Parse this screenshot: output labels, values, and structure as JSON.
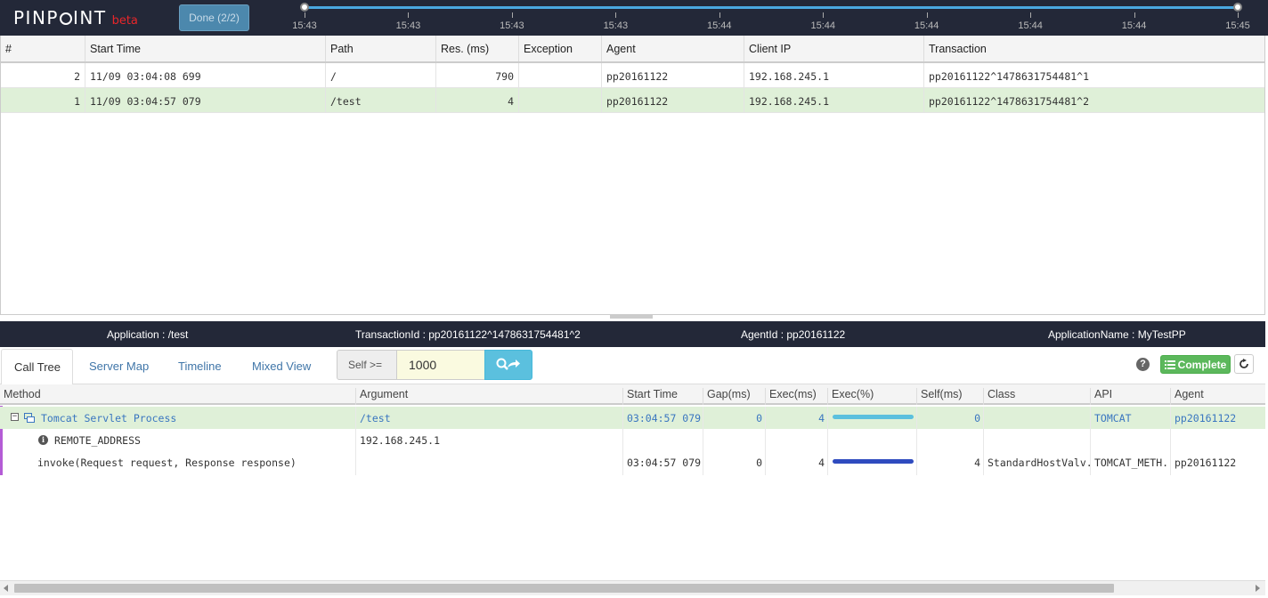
{
  "header": {
    "logo_text_a": "PINP",
    "logo_text_b": "INT",
    "logo_beta": "beta",
    "done_button": "Done (2/2)",
    "timeline_labels": [
      "15:43",
      "15:43",
      "15:43",
      "15:43",
      "15:44",
      "15:44",
      "15:44",
      "15:44",
      "15:44",
      "15:45"
    ],
    "colors": {
      "bg": "#232838",
      "track": "#4aa8e0",
      "beta": "#e8262a"
    }
  },
  "transactions": {
    "columns": [
      "#",
      "Start Time",
      "Path",
      "Res. (ms)",
      "Exception",
      "Agent",
      "Client IP",
      "Transaction"
    ],
    "rows": [
      {
        "num": "2",
        "start_time": "11/09 03:04:08 699",
        "path": "/",
        "res": "790",
        "exception": "",
        "agent": "pp20161122",
        "client_ip": "192.168.245.1",
        "transaction": "pp20161122^1478631754481^1"
      },
      {
        "num": "1",
        "start_time": "11/09 03:04:57 079",
        "path": "/test",
        "res": "4",
        "exception": "",
        "agent": "pp20161122",
        "client_ip": "192.168.245.1",
        "transaction": "pp20161122^1478631754481^2"
      }
    ]
  },
  "infobar": {
    "application": "Application : /test",
    "transaction_id": "TransactionId : pp20161122^1478631754481^2",
    "agent_id": "AgentId : pp20161122",
    "application_name": "ApplicationName : MyTestPP"
  },
  "tabs": {
    "call_tree": "Call Tree",
    "server_map": "Server Map",
    "timeline": "Timeline",
    "mixed_view": "Mixed View",
    "self_label": "Self >=",
    "self_value": "1000",
    "help": "?",
    "complete": "Complete"
  },
  "calltree": {
    "columns": [
      "Method",
      "Argument",
      "Start Time",
      "Gap(ms)",
      "Exec(ms)",
      "Exec(%)",
      "Self(ms)",
      "Class",
      "API",
      "Agent"
    ],
    "rows": [
      {
        "method": "Tomcat Servlet Process",
        "argument": "/test",
        "start_time": "03:04:57 079",
        "gap": "0",
        "exec": "4",
        "exec_pct": 1.0,
        "self": "0",
        "class": "",
        "api": "TOMCAT",
        "agent": "pp20161122"
      },
      {
        "method": "REMOTE_ADDRESS",
        "argument": "192.168.245.1",
        "start_time": "",
        "gap": "",
        "exec": "",
        "exec_pct": null,
        "self": "",
        "class": "",
        "api": "",
        "agent": ""
      },
      {
        "method": "invoke(Request request, Response response)",
        "argument": "",
        "start_time": "03:04:57 079",
        "gap": "0",
        "exec": "4",
        "exec_pct": 1.0,
        "self": "4",
        "class": "StandardHostValv.",
        "api": "TOMCAT_METH..",
        "agent": "pp20161122"
      }
    ],
    "colors": {
      "bar1": "#5bc0de",
      "bar2": "#2f4bbf",
      "selected_bg": "#dff0d8",
      "left_marker": "#b45cd6"
    }
  }
}
